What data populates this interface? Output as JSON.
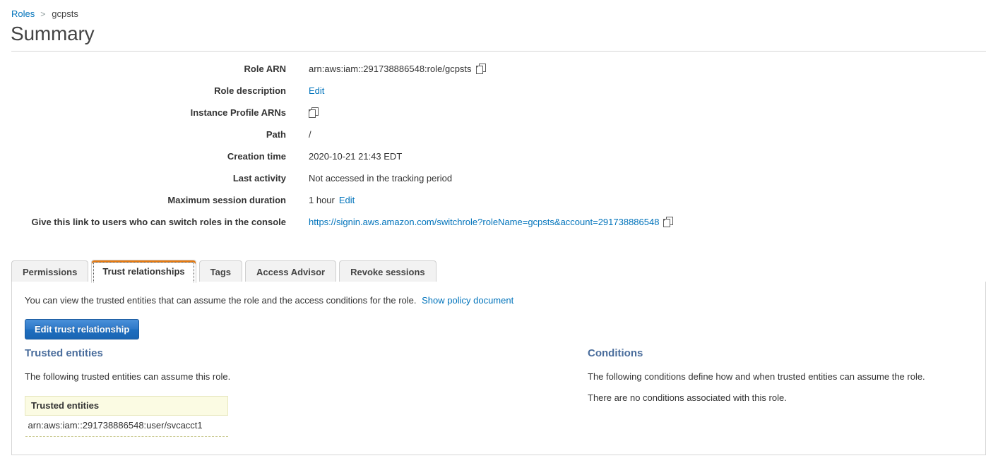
{
  "breadcrumb": {
    "root_label": "Roles",
    "separator": ">",
    "current_label": "gcpsts"
  },
  "page_title": "Summary",
  "details": [
    {
      "label": "Role ARN",
      "value": "arn:aws:iam::291738886548:role/gcpsts",
      "copy_icon": "copy-icon"
    },
    {
      "label": "Role description",
      "link": "Edit"
    },
    {
      "label": "Instance Profile ARNs",
      "value": "",
      "copy_icon": "copy-icon"
    },
    {
      "label": "Path",
      "value": "/"
    },
    {
      "label": "Creation time",
      "value": "2020-10-21 21:43 EDT"
    },
    {
      "label": "Last activity",
      "value": "Not accessed in the tracking period"
    },
    {
      "label": "Maximum session duration",
      "value": "1 hour",
      "link": "Edit"
    },
    {
      "label": "Give this link to users who can switch roles in the console",
      "link": "https://signin.aws.amazon.com/switchrole?roleName=gcpsts&account=291738886548",
      "copy_icon": "copy-icon"
    }
  ],
  "tabs": [
    {
      "label": "Permissions",
      "active": false
    },
    {
      "label": "Trust relationships",
      "active": true
    },
    {
      "label": "Tags",
      "active": false
    },
    {
      "label": "Access Advisor",
      "active": false
    },
    {
      "label": "Revoke sessions",
      "active": false
    }
  ],
  "trust_tab": {
    "intro_text": "You can view the trusted entities that can assume the role and the access conditions for the role.",
    "intro_link": "Show policy document",
    "edit_button": "Edit trust relationship",
    "trusted_entities": {
      "heading": "Trusted entities",
      "description": "The following trusted entities can assume this role.",
      "table_header": "Trusted entities",
      "rows": [
        "arn:aws:iam::291738886548:user/svcacct1"
      ]
    },
    "conditions": {
      "heading": "Conditions",
      "description": "The following conditions define how and when trusted entities can assume the role.",
      "empty_text": "There are no conditions associated with this role."
    }
  },
  "colors": {
    "link_blue": "#0073bb",
    "heading_blue": "#4a6d9c",
    "active_tab_accent": "#e47911",
    "primary_button": "#2d78c8",
    "table_header_bg": "#fbfbe3"
  }
}
